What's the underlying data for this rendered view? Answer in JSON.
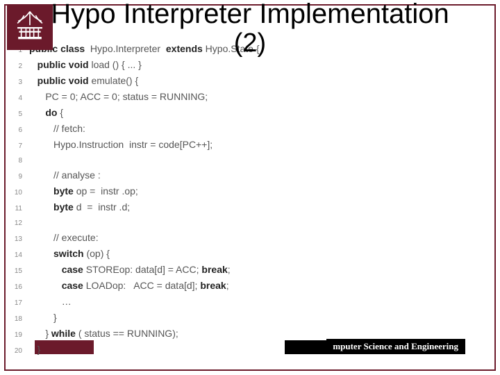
{
  "title": {
    "line1": "Hypo Interpreter Implementation",
    "line2": "(2)"
  },
  "footer": {
    "dept": "mputer Science and Engineering"
  },
  "code": [
    {
      "n": 1,
      "indent": 0,
      "tokens": [
        {
          "t": "public class",
          "k": 1
        },
        {
          "t": "  Hypo.Interpreter  "
        },
        {
          "t": "extends",
          "k": 1
        },
        {
          "t": " Hypo.State {"
        }
      ]
    },
    {
      "n": 2,
      "indent": 1,
      "tokens": [
        {
          "t": "public void",
          "k": 1
        },
        {
          "t": " load () { ... }"
        }
      ]
    },
    {
      "n": 3,
      "indent": 1,
      "tokens": [
        {
          "t": "public void",
          "k": 1
        },
        {
          "t": " emulate() {"
        }
      ]
    },
    {
      "n": 4,
      "indent": 2,
      "tokens": [
        {
          "t": "PC = 0; ACC = 0; status = RUNNING;"
        }
      ]
    },
    {
      "n": 5,
      "indent": 2,
      "tokens": [
        {
          "t": "do",
          "k": 1
        },
        {
          "t": " {"
        }
      ]
    },
    {
      "n": 6,
      "indent": 3,
      "tokens": [
        {
          "t": "// fetch:"
        }
      ]
    },
    {
      "n": 7,
      "indent": 3,
      "tokens": [
        {
          "t": "Hypo.Instruction  instr = code[PC++];"
        }
      ]
    },
    {
      "n": 8,
      "indent": 0,
      "tokens": [
        {
          "t": ""
        }
      ]
    },
    {
      "n": 9,
      "indent": 3,
      "tokens": [
        {
          "t": "// analyse :"
        }
      ]
    },
    {
      "n": 10,
      "indent": 3,
      "tokens": [
        {
          "t": "byte",
          "k": 1
        },
        {
          "t": " op =  instr .op;"
        }
      ]
    },
    {
      "n": 11,
      "indent": 3,
      "tokens": [
        {
          "t": "byte",
          "k": 1
        },
        {
          "t": " d  =  instr .d;"
        }
      ]
    },
    {
      "n": 12,
      "indent": 0,
      "tokens": [
        {
          "t": ""
        }
      ]
    },
    {
      "n": 13,
      "indent": 3,
      "tokens": [
        {
          "t": "// execute:"
        }
      ]
    },
    {
      "n": 14,
      "indent": 3,
      "tokens": [
        {
          "t": "switch",
          "k": 1
        },
        {
          "t": " (op) {"
        }
      ]
    },
    {
      "n": 15,
      "indent": 4,
      "tokens": [
        {
          "t": "case",
          "k": 1
        },
        {
          "t": " STOREop: data[d] = ACC; "
        },
        {
          "t": "break",
          "k": 1
        },
        {
          "t": ";"
        }
      ]
    },
    {
      "n": 16,
      "indent": 4,
      "tokens": [
        {
          "t": "case",
          "k": 1
        },
        {
          "t": " LOADop:   ACC = data[d]; "
        },
        {
          "t": "break",
          "k": 1
        },
        {
          "t": ";"
        }
      ]
    },
    {
      "n": 17,
      "indent": 4,
      "tokens": [
        {
          "t": "…"
        }
      ]
    },
    {
      "n": 18,
      "indent": 3,
      "tokens": [
        {
          "t": "}"
        }
      ]
    },
    {
      "n": 19,
      "indent": 2,
      "tokens": [
        {
          "t": "} "
        },
        {
          "t": "while",
          "k": 1
        },
        {
          "t": " ( status == RUNNING);"
        }
      ]
    },
    {
      "n": 20,
      "indent": 1,
      "tokens": [
        {
          "t": "}"
        }
      ]
    }
  ]
}
